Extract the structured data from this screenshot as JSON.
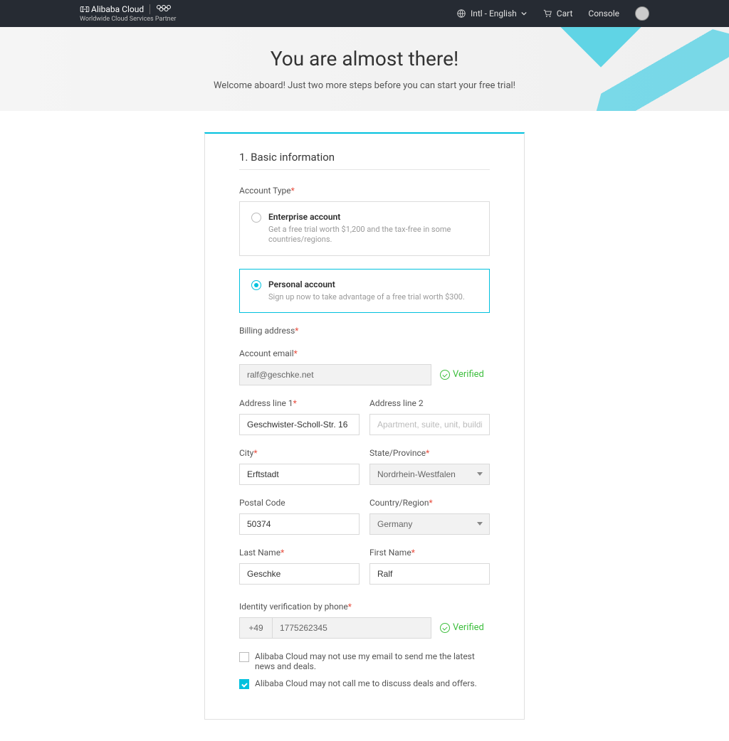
{
  "header": {
    "brand_name": "Alibaba Cloud",
    "tagline": "Worldwide Cloud Services Partner",
    "language_label": "Intl - English",
    "cart_label": "Cart",
    "console_label": "Console"
  },
  "hero": {
    "title": "You are almost there!",
    "subtitle": "Welcome aboard! Just two more steps before you can start your free trial!"
  },
  "section": {
    "title": "1. Basic information"
  },
  "account_type": {
    "label": "Account Type",
    "options": [
      {
        "title": "Enterprise account",
        "desc": "Get a free trial worth $1,200 and the tax-free in some countries/regions.",
        "selected": false
      },
      {
        "title": "Personal account",
        "desc": "Sign up now to take advantage of a free trial worth $300.",
        "selected": true
      }
    ]
  },
  "billing": {
    "section_label": "Billing address",
    "email_label": "Account email",
    "email_value": "ralf@geschke.net",
    "verified_label": "Verified",
    "addr1_label": "Address line 1",
    "addr1_value": "Geschwister-Scholl-Str. 16",
    "addr2_label": "Address line 2",
    "addr2_placeholder": "Apartment, suite, unit, building, floo",
    "city_label": "City",
    "city_value": "Erftstadt",
    "state_label": "State/Province",
    "state_value": "Nordrhein-Westfalen",
    "postal_label": "Postal Code",
    "postal_value": "50374",
    "country_label": "Country/Region",
    "country_value": "Germany",
    "lastname_label": "Last Name",
    "lastname_value": "Geschke",
    "firstname_label": "First Name",
    "firstname_value": "Ralf"
  },
  "phone_verify": {
    "label": "Identity verification by phone",
    "code_value": "+49",
    "number_value": "1775262345",
    "verified_label": "Verified"
  },
  "consent": {
    "email_optout": "Alibaba Cloud may not use my email to send me the latest news and deals.",
    "call_optout": "Alibaba Cloud may not call me to discuss deals and offers."
  }
}
